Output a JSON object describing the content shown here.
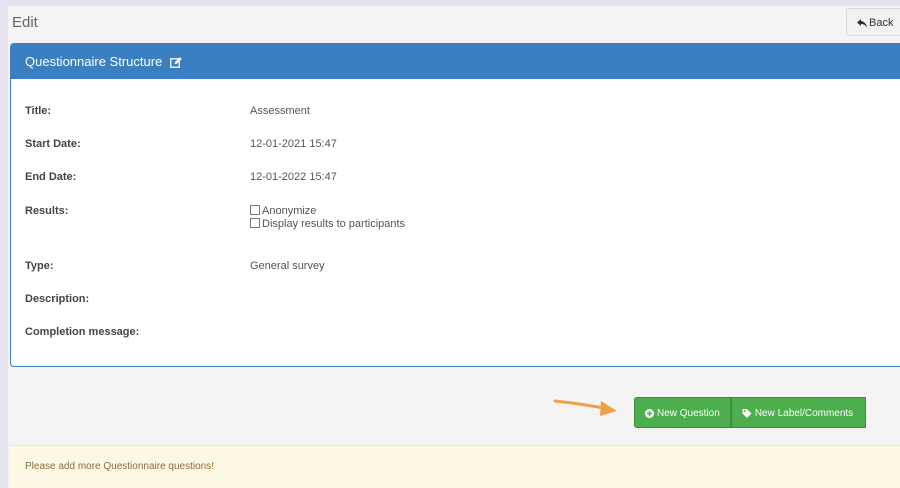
{
  "page": {
    "title": "Edit"
  },
  "back_button": {
    "label": "Back",
    "icon": "reply-icon"
  },
  "panel": {
    "title": "Questionnaire Structure",
    "icon": "edit-icon",
    "fields": {
      "title": {
        "label": "Title:",
        "value": "Assessment"
      },
      "start_date": {
        "label": "Start Date:",
        "value": "12-01-2021 15:47"
      },
      "end_date": {
        "label": "End Date:",
        "value": "12-01-2022 15:47"
      },
      "results": {
        "label": "Results:",
        "options": [
          {
            "label": "Anonymize",
            "checked": false
          },
          {
            "label": "Display results to participants",
            "checked": false
          }
        ]
      },
      "type": {
        "label": "Type:",
        "value": "General survey"
      },
      "description": {
        "label": "Description:",
        "value": ""
      },
      "completion_message": {
        "label": "Completion message:",
        "value": ""
      }
    }
  },
  "actions": {
    "new_question": "New Question",
    "new_label": "New Label/Comments"
  },
  "alert": {
    "message": "Please add more Questionnaire questions!"
  },
  "colors": {
    "header_blue": "#3a7fc1",
    "button_green": "#4cae4c",
    "arrow_orange": "#f0a04b",
    "alert_bg": "#fcf8e3"
  }
}
